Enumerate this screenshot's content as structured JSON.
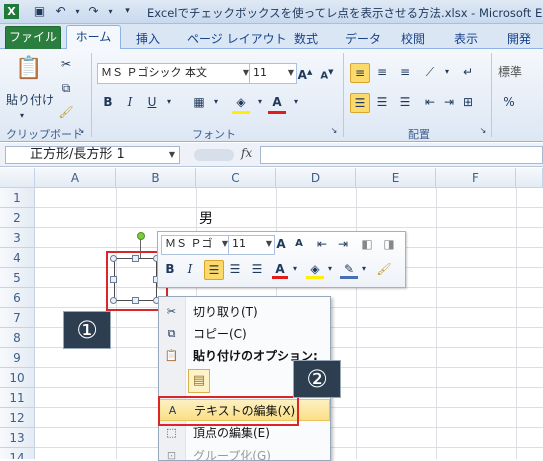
{
  "title_bar": {
    "title": "Excelでチェックボックスを使ってレ点を表示させる方法.xlsx - Microsoft Excel"
  },
  "tabs": [
    "ファイル",
    "ホーム",
    "挿入",
    "ページ レイアウト",
    "数式",
    "データ",
    "校閲",
    "表示",
    "開発"
  ],
  "ribbon": {
    "clipboard": {
      "paste_label": "貼り付け",
      "group_label": "クリップボード"
    },
    "font": {
      "font_name": "ＭＳ Ｐゴシック 本文",
      "font_size": "11",
      "group_label": "フォント"
    },
    "alignment": {
      "group_label": "配置"
    },
    "styles": {
      "partial_label": "標準"
    }
  },
  "formula_bar": {
    "name_box": "正方形/長方形 1",
    "fx": "fx",
    "value": ""
  },
  "sheet": {
    "columns": [
      "A",
      "B",
      "C",
      "D",
      "E",
      "F"
    ],
    "rows": [
      "1",
      "2",
      "3",
      "4",
      "5",
      "6",
      "7",
      "8",
      "9",
      "10",
      "11",
      "12",
      "13",
      "14"
    ],
    "cell_text": "男"
  },
  "mini_toolbar": {
    "font_name": "ＭＳ Ｐゴ",
    "font_size": "11"
  },
  "context_menu": {
    "items": [
      {
        "label": "切り取り(T)"
      },
      {
        "label": "コピー(C)"
      },
      {
        "label": "貼り付けのオプション:"
      },
      {
        "label": "テキストの編集(X)"
      },
      {
        "label": "頂点の編集(E)"
      },
      {
        "label": "グループ化(G)"
      }
    ]
  },
  "annotations": {
    "one": "①",
    "two": "②"
  },
  "colors": {
    "file_tab": "#2a7f3f",
    "highlight_outline": "#d9262b",
    "badge": "#2d3e50",
    "menu_highlight": "#fbdf86"
  }
}
